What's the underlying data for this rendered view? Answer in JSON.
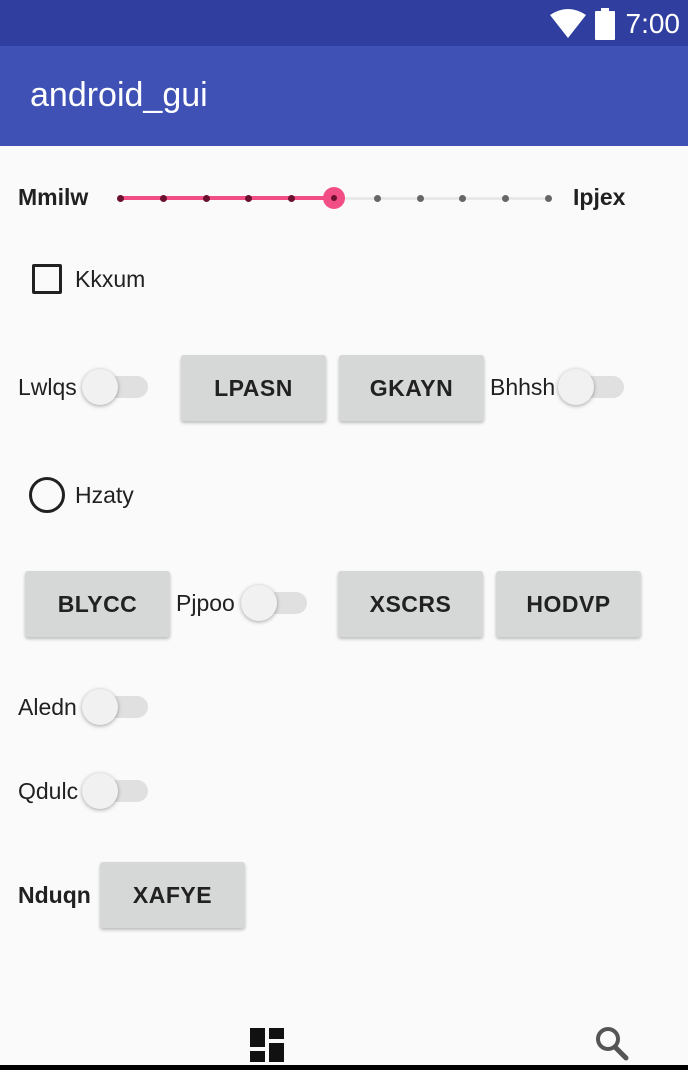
{
  "status_bar": {
    "time": "7:00",
    "icons": [
      "wifi-icon",
      "battery-icon"
    ]
  },
  "app_bar": {
    "title": "android_gui"
  },
  "slider": {
    "left_label": "Mmilw",
    "right_label": "Ipjex",
    "steps": 10,
    "value": 5
  },
  "checkbox": {
    "label": "Kkxum",
    "checked": false
  },
  "row1": {
    "switch1_label": "Lwlqs",
    "button1": "LPASN",
    "button2": "GKAYN",
    "switch2_label": "Bhhsh"
  },
  "radio": {
    "label": "Hzaty",
    "checked": false
  },
  "row2": {
    "button1": "BLYCC",
    "switch_label": "Pjpoo",
    "button2": "XSCRS",
    "button3": "HODVP"
  },
  "switch_aledn": {
    "label": "Aledn"
  },
  "switch_qdulc": {
    "label": "Qdulc"
  },
  "row3": {
    "label": "Nduqn",
    "button": "XAFYE"
  },
  "bottom_nav": {
    "items": [
      "dashboard-icon",
      "search-icon"
    ]
  },
  "colors": {
    "primary": "#3f51b5",
    "primary_dark": "#303f9f",
    "accent": "#f24e86"
  }
}
